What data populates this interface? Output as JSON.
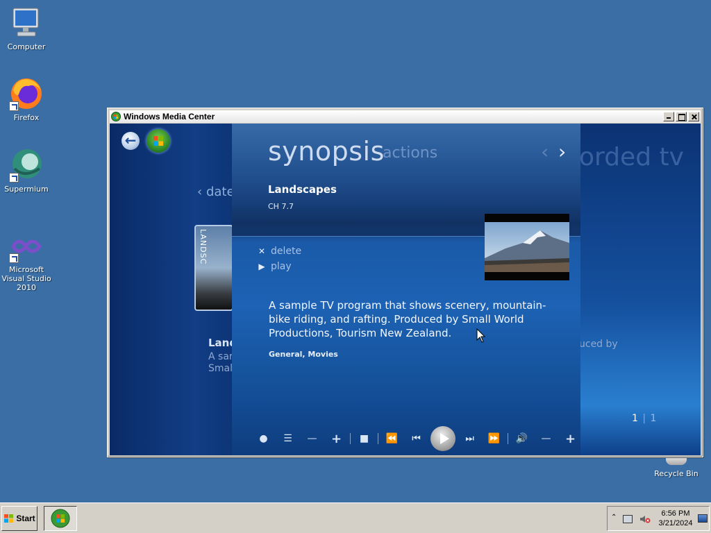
{
  "desktop": {
    "icons": [
      {
        "label": "Computer"
      },
      {
        "label": "Firefox"
      },
      {
        "label": "Supermium"
      },
      {
        "label": "Microsoft Visual Studio 2010"
      }
    ],
    "recycle_bin": "Recycle Bin"
  },
  "window": {
    "title": "Windows Media Center"
  },
  "background_page": {
    "sort_label": "date",
    "thumb_label": "LANDSC",
    "left_title": "Land",
    "left_line1": "A sar",
    "left_line2": "Smal",
    "right_title": "orded tv",
    "right_line": "uced by",
    "page_current": "1",
    "page_separator": "|",
    "page_total": "1"
  },
  "dialog": {
    "tab_active": "synopsis",
    "tab_inactive": "actions",
    "program_title": "Landscapes",
    "channel": "CH 7.7",
    "actions": [
      {
        "glyph": "✕",
        "label": "delete"
      },
      {
        "glyph": "▶",
        "label": "play"
      }
    ],
    "synopsis": "A sample TV program that shows scenery, mountain-bike riding, and rafting. Produced by Small World Productions, Tourism New Zealand.",
    "genres": "General, Movies"
  },
  "transport": {
    "icons": [
      "record-icon",
      "guide-icon",
      "channel-down-icon",
      "channel-up-icon",
      "stop-icon",
      "rewind-icon",
      "skip-back-icon",
      "play-icon",
      "skip-forward-icon",
      "fast-forward-icon",
      "mute-icon",
      "volume-down-icon",
      "volume-up-icon"
    ]
  },
  "taskbar": {
    "start_label": "Start",
    "time": "6:56 PM",
    "date": "3/21/2024"
  }
}
